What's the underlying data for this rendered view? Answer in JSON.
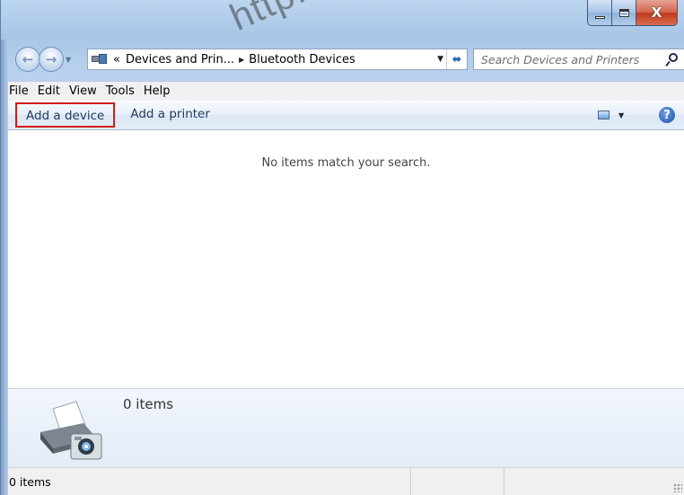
{
  "window": {
    "watermark": "http://w..."
  },
  "caption": {
    "minimize_icon": "minimize-icon",
    "maximize_icon": "maximize-icon",
    "close_label": "X"
  },
  "nav": {
    "back_icon": "back-arrow-icon",
    "forward_icon": "forward-arrow-icon"
  },
  "address": {
    "overflow": "«",
    "breadcrumbs": [
      "Devices and Prin...",
      "Bluetooth Devices"
    ]
  },
  "search": {
    "placeholder": "Search Devices and Printers"
  },
  "menu": {
    "items": [
      "File",
      "Edit",
      "View",
      "Tools",
      "Help"
    ]
  },
  "commands": {
    "add_device": "Add a device",
    "add_printer": "Add a printer",
    "help_label": "?"
  },
  "content": {
    "empty_message": "No items match your search."
  },
  "details": {
    "count": "0 items"
  },
  "status": {
    "count": "0 items"
  },
  "colors": {
    "highlight_border": "#d21a1a",
    "command_text": "#1e395b",
    "window_chrome": "#a9c6e7"
  }
}
